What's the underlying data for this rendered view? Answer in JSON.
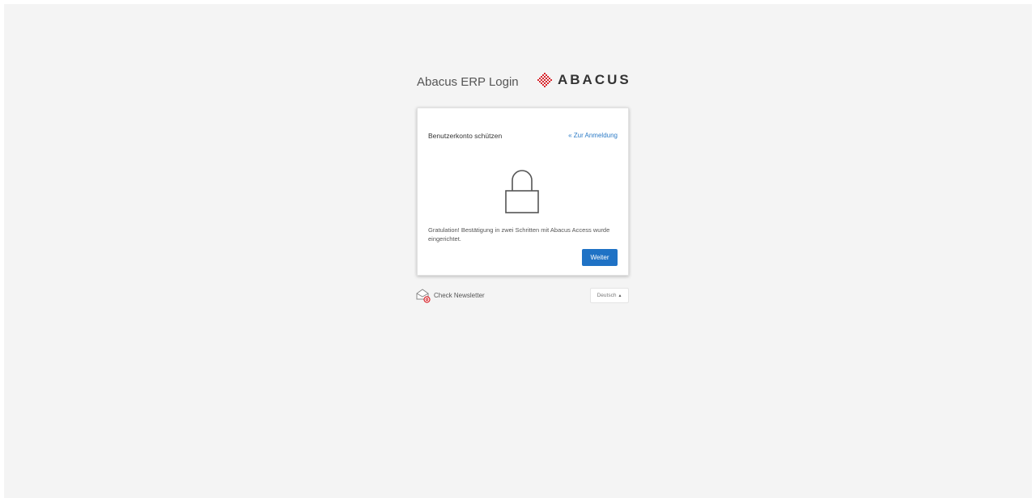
{
  "header": {
    "title": "Abacus ERP Login",
    "logo_text": "ABACUS",
    "logo_icon": "abacus-diamond-logo",
    "brand_color": "#d9262c"
  },
  "card": {
    "title": "Benutzerkonto schützen",
    "back_link": "« Zur Anmeldung",
    "icon": "lock-icon",
    "message": "Gratulation! Bestätigung in zwei Schritten mit Abacus Access wurde eingerichtet.",
    "continue_button": "Weiter",
    "accent_color": "#1f72c5"
  },
  "footer": {
    "newsletter_label": "Check Newsletter",
    "newsletter_icon": "envelope-at-icon",
    "language": {
      "selected": "Deutsch",
      "caret": "▲"
    }
  }
}
